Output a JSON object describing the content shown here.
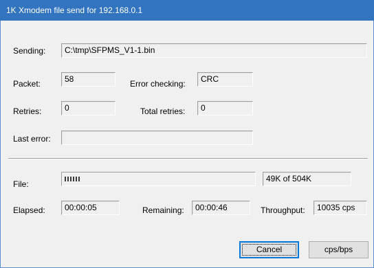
{
  "window": {
    "title": "1K Xmodem file send for 192.168.0.1"
  },
  "labels": {
    "sending": "Sending:",
    "packet": "Packet:",
    "error_checking": "Error checking:",
    "retries": "Retries:",
    "total_retries": "Total retries:",
    "last_error": "Last error:",
    "file": "File:",
    "elapsed": "Elapsed:",
    "remaining": "Remaining:",
    "throughput": "Throughput:"
  },
  "values": {
    "sending": "C:\\tmp\\SFPMS_V1-1.bin",
    "packet": "58",
    "error_checking": "CRC",
    "retries": "0",
    "total_retries": "0",
    "last_error": "",
    "file_progress_text": "49K of 504K",
    "file_progress_fraction": 0.097,
    "elapsed": "00:00:05",
    "remaining": "00:00:46",
    "throughput": "10035 cps"
  },
  "buttons": {
    "cancel": "Cancel",
    "cps_bps": "cps/bps"
  }
}
